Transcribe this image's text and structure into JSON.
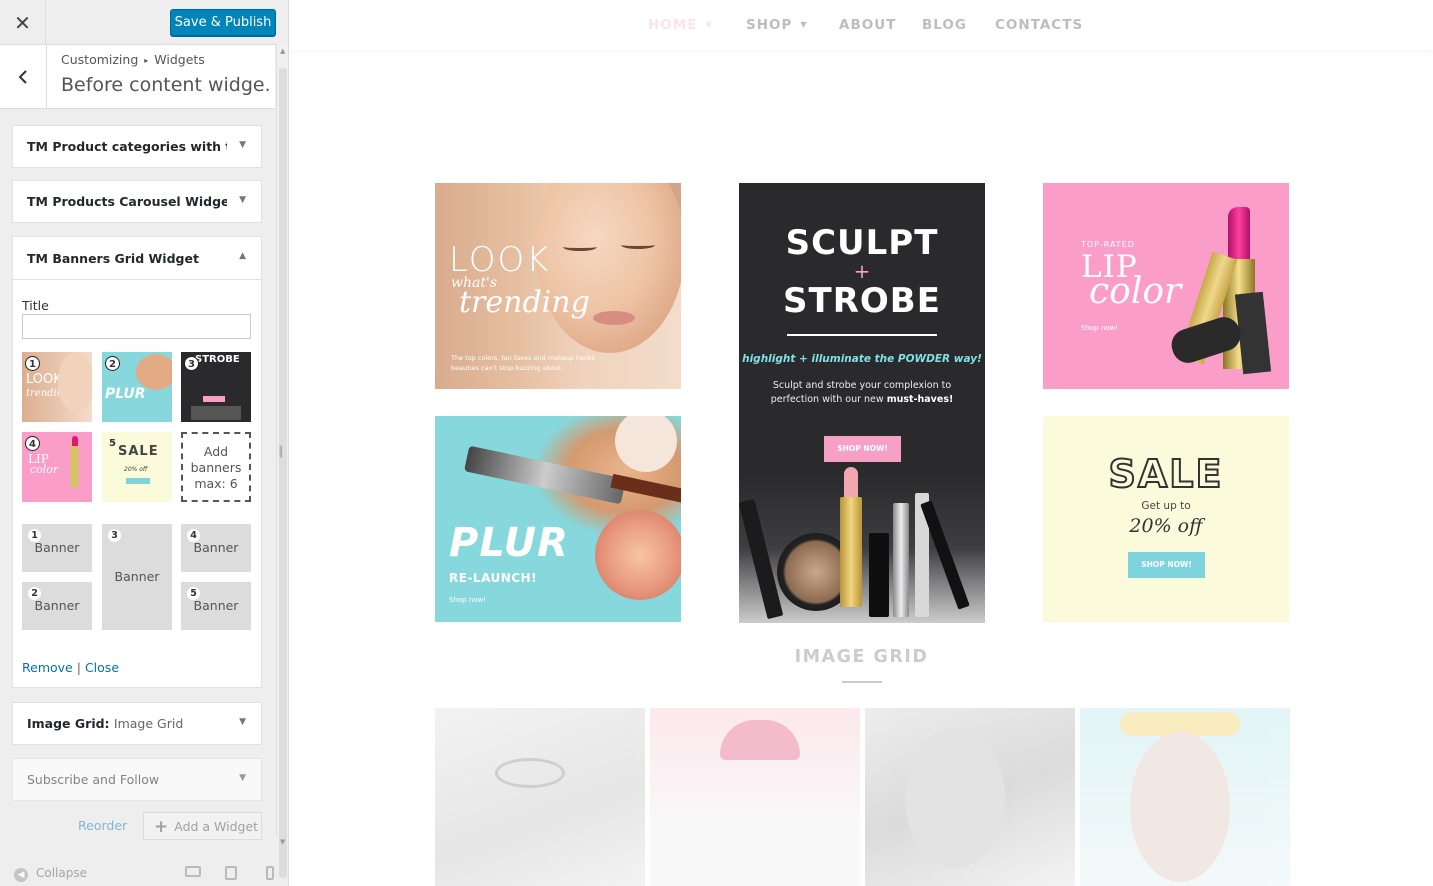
{
  "sidebar": {
    "publish_label": "Save & Publish",
    "breadcrumb_root": "Customizing",
    "breadcrumb_current": "Widgets",
    "section_title": "Before content widge...",
    "widgets": [
      {
        "title": "TM Product categories with t..."
      },
      {
        "title": "TM Products Carousel Widget..."
      },
      {
        "title": "TM Banners Grid Widget"
      },
      {
        "title": "Image Grid:",
        "subtitle": "Image Grid"
      },
      {
        "title": "Subscribe and Follow"
      }
    ],
    "banner_widget": {
      "title_label": "Title",
      "title_value": "",
      "thumbnails": [
        "1",
        "2",
        "3",
        "4",
        "5"
      ],
      "add_banners": "Add banners max: 6",
      "slots": [
        {
          "num": "1",
          "label": "Banner"
        },
        {
          "num": "2",
          "label": "Banner"
        },
        {
          "num": "3",
          "label": "Banner"
        },
        {
          "num": "4",
          "label": "Banner"
        },
        {
          "num": "5",
          "label": "Banner"
        }
      ],
      "remove_link": "Remove",
      "close_link": "Close"
    },
    "reorder_label": "Reorder",
    "add_widget_label": "Add a Widget",
    "collapse_label": "Collapse"
  },
  "preview": {
    "nav": [
      {
        "label": "HOME",
        "has_caret": true,
        "active": true
      },
      {
        "label": "SHOP",
        "has_caret": true
      },
      {
        "label": "ABOUT"
      },
      {
        "label": "BLOG"
      },
      {
        "label": "CONTACTS"
      }
    ],
    "banners": {
      "b1": {
        "title": "LOOK",
        "whats": "what's",
        "trending": "trending",
        "text": "The top colors, fan faves and makeup hacks beauties can't stop buzzing about."
      },
      "b2": {
        "line1": "SCULPT",
        "plus": "+",
        "line2": "STROBE",
        "highlight": "highlight + illuminate the POWDER way!",
        "desc_pre": "Sculpt and strobe your complexion to perfection with our new",
        "desc_bold": "must-haves!",
        "button": "SHOP NOW!"
      },
      "b3": {
        "top": "TOP-RATED",
        "lip": "LIP",
        "color": "color",
        "shop": "Shop now!"
      },
      "b4": {
        "title": "PLUR",
        "sub": "RE-LAUNCH!",
        "shop": "Shop now!"
      },
      "b5": {
        "title": "SALE",
        "get": "Get up to",
        "off": "20% off",
        "button": "SHOP NOW!"
      }
    },
    "image_grid_title": "IMAGE GRID"
  },
  "colors": {
    "accent": "#0085ba",
    "link": "#0073aa",
    "pink": "#fa9ec9",
    "teal": "#86d8dc",
    "cream": "#fbfbdc"
  }
}
